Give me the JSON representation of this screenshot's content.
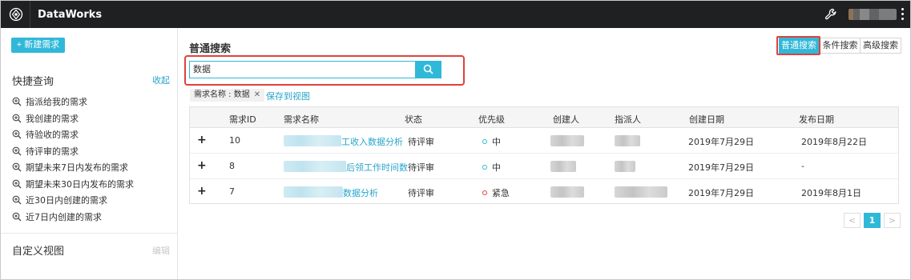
{
  "app": {
    "title": "DataWorks"
  },
  "icons": {
    "logo": "dataworks-logo-icon",
    "tool": "wrench-icon",
    "more": "more-vertical-icon",
    "search": "search-icon",
    "query": "zoom-in-icon",
    "close": "close-icon"
  },
  "colors": {
    "accent": "#30b8d8",
    "topbar": "#1e2022",
    "link": "#2aa4cc",
    "highlight": "#e0413d"
  },
  "sidebar": {
    "new_button": "+ 新建需求",
    "quick_title": "快捷查询",
    "collapse": "收起",
    "quick_items": [
      "指派给我的需求",
      "我创建的需求",
      "待验收的需求",
      "待评审的需求",
      "期望未来7日内发布的需求",
      "期望未来30日内发布的需求",
      "近30日内创建的需求",
      "近7日内创建的需求"
    ],
    "custom_title": "自定义视图",
    "edit": "编辑"
  },
  "main": {
    "section_title": "普通搜索",
    "search_modes": [
      "普通搜索",
      "条件搜索",
      "高级搜索"
    ],
    "active_mode": "普通搜索",
    "search_value": "数据",
    "filter_tag": "需求名称 : 数据",
    "save_view": "保存到视图"
  },
  "table": {
    "headers": [
      "需求ID",
      "需求名称",
      "状态",
      "优先级",
      "创建人",
      "指派人",
      "创建日期",
      "发布日期"
    ],
    "rows": [
      {
        "id": "10",
        "name_visible": "工收入数据分析",
        "status": "待评审",
        "priority": "中",
        "priority_color": "#30b8d8",
        "created": "2019年7月29日",
        "published": "2019年8月22日"
      },
      {
        "id": "8",
        "name_visible": "后领工作时间数",
        "status": "待评审",
        "priority": "中",
        "priority_color": "#30b8d8",
        "created": "2019年7月29日",
        "published": "-"
      },
      {
        "id": "7",
        "name_visible": "数据分析",
        "status": "待评审",
        "priority": "紧急",
        "priority_color": "#e0413d",
        "created": "2019年7月29日",
        "published": "2019年8月1日"
      }
    ],
    "expand_symbol": "+"
  },
  "pagination": {
    "prev": "<",
    "current": "1",
    "next": ">"
  }
}
